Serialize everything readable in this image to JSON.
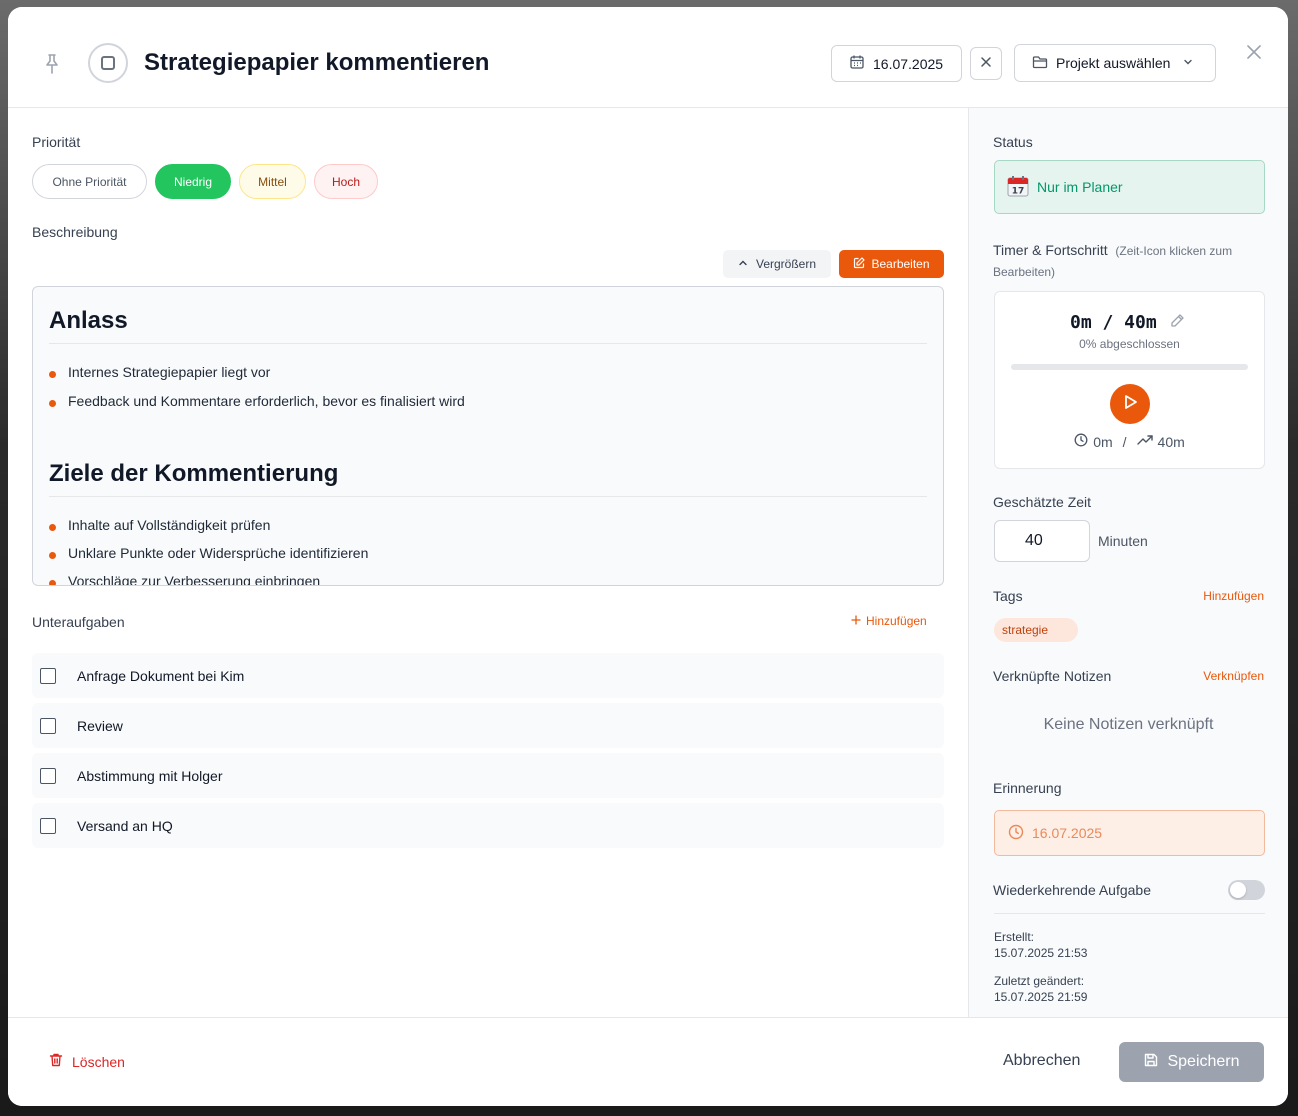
{
  "header": {
    "title": "Strategiepapier kommentieren",
    "date": "16.07.2025",
    "project_label": "Projekt auswählen"
  },
  "priority": {
    "label": "Priorität",
    "options": [
      "Ohne Priorität",
      "Niedrig",
      "Mittel",
      "Hoch"
    ],
    "selected": "Niedrig"
  },
  "description": {
    "label": "Beschreibung",
    "expand_label": "Vergrößern",
    "edit_label": "Bearbeiten",
    "content": {
      "h1": "Anlass",
      "items1": [
        "Internes Strategiepapier liegt vor",
        "Feedback und Kommentare erforderlich, bevor es finalisiert wird"
      ],
      "h2": "Ziele der Kommentierung",
      "items2": [
        "Inhalte auf Vollständigkeit prüfen",
        "Unklare Punkte oder Widersprüche identifizieren",
        "Vorschläge zur Verbesserung einbringen"
      ]
    }
  },
  "subtasks": {
    "label": "Unteraufgaben",
    "add_label": "Hinzufügen",
    "items": [
      "Anfrage Dokument bei Kim",
      "Review",
      "Abstimmung mit Holger",
      "Versand an HQ"
    ]
  },
  "sidebar": {
    "status_label": "Status",
    "status_value": "Nur im Planer",
    "timer_label": "Timer & Fortschritt",
    "timer_hint": "(Zeit-Icon klicken zum Bearbeiten)",
    "timer_value": "0m / 40m",
    "timer_percent_text": "0% abgeschlossen",
    "timer_progress": 0,
    "timer_spent": "0m",
    "timer_separator": "/",
    "timer_estimate": "40m",
    "estimate_label": "Geschätzte Zeit",
    "estimate_value": "40",
    "estimate_unit": "Minuten",
    "tags_label": "Tags",
    "tags_add": "Hinzufügen",
    "tags": [
      "strategie"
    ],
    "notes_label": "Verknüpfte Notizen",
    "notes_link": "Verknüpfen",
    "notes_empty": "Keine Notizen verknüpft",
    "reminder_label": "Erinnerung",
    "reminder_value": "16.07.2025",
    "recurring_label": "Wiederkehrende Aufgabe",
    "recurring_on": false,
    "created_label": "Erstellt:",
    "created_value": "15.07.2025 21:53",
    "modified_label": "Zuletzt geändert:",
    "modified_value": "15.07.2025 21:59"
  },
  "footer": {
    "delete_label": "Löschen",
    "cancel_label": "Abbrechen",
    "save_label": "Speichern"
  },
  "colors": {
    "accent": "#ea580c",
    "priority_low": "#22c55e",
    "status_green": "#059669",
    "danger": "#dc2626"
  }
}
